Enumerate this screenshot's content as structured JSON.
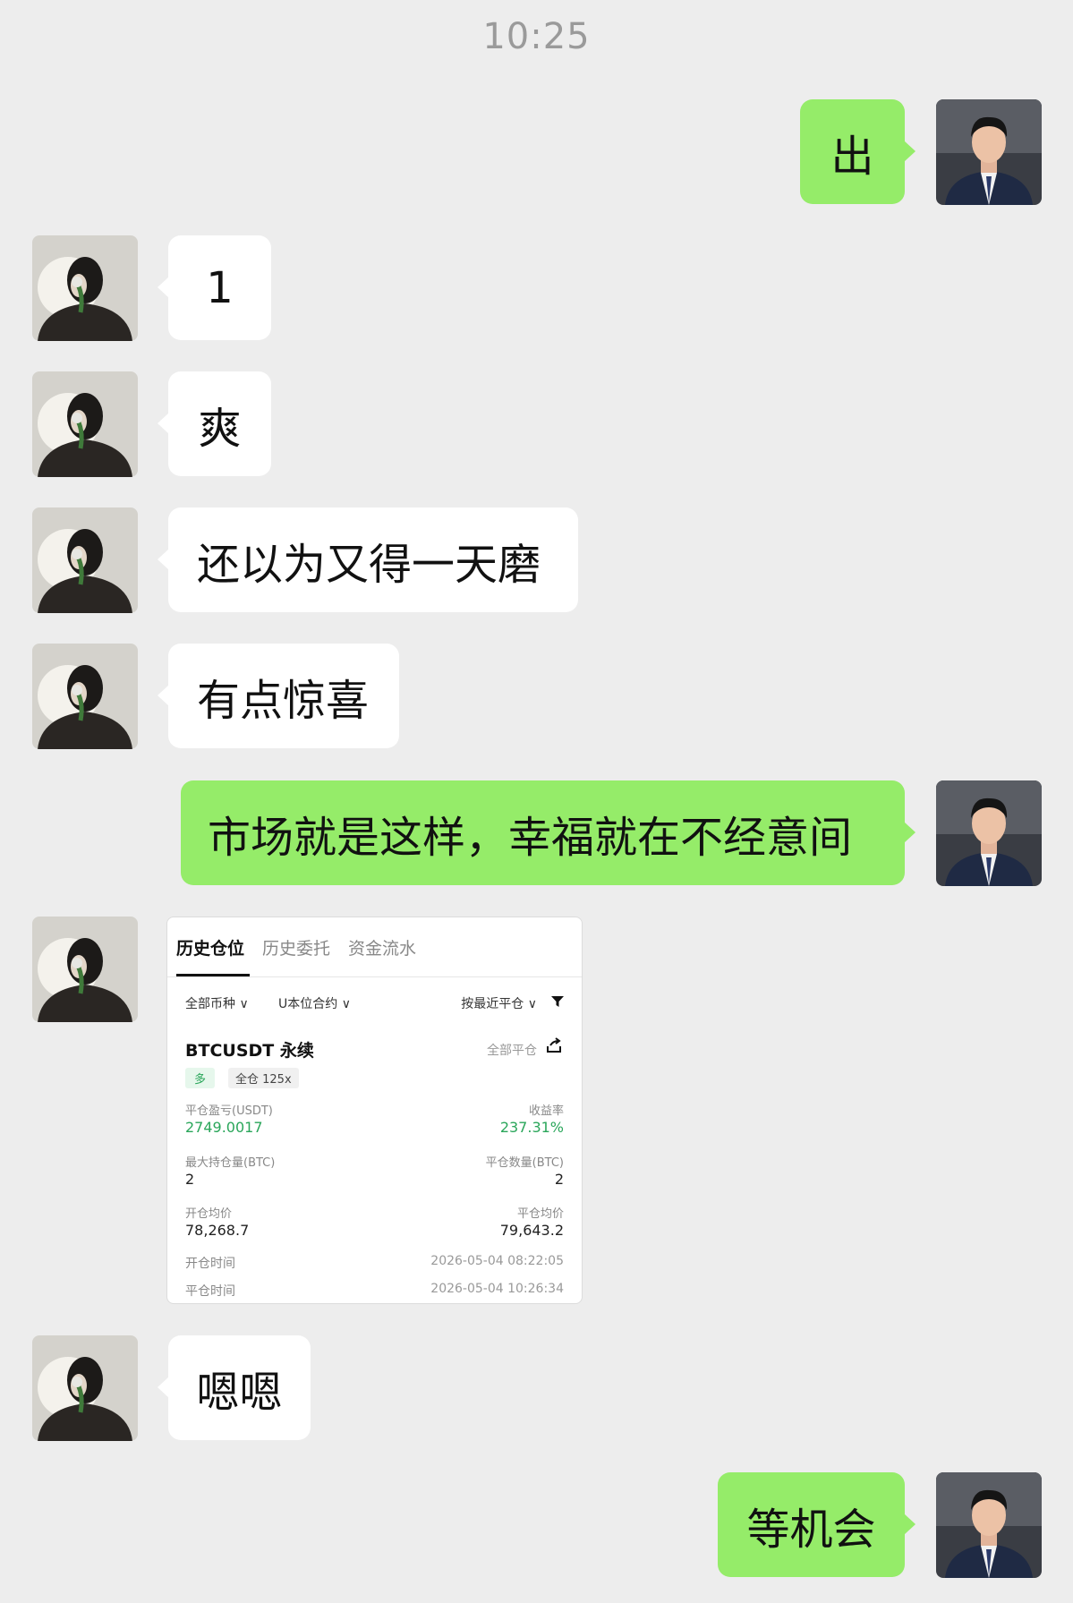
{
  "timestamp": "10:25",
  "messages": [
    {
      "side": "right",
      "text": "出"
    },
    {
      "side": "left",
      "text": "1"
    },
    {
      "side": "left",
      "text": "爽"
    },
    {
      "side": "left",
      "text": "还以为又得一天磨"
    },
    {
      "side": "left",
      "text": "有点惊喜"
    },
    {
      "side": "right",
      "text": "市场就是这样，幸福就在不经意间"
    },
    {
      "side": "left",
      "type": "image"
    },
    {
      "side": "left",
      "text": "嗯嗯"
    },
    {
      "side": "right",
      "text": "等机会"
    }
  ],
  "shared_image": {
    "tabs": [
      "历史仓位",
      "历史委托",
      "资金流水"
    ],
    "filters": {
      "coin": "全部币种 ∨",
      "contract": "U本位合约 ∨",
      "sort": "按最近平仓 ∨",
      "filter_icon": "funnel-icon"
    },
    "symbol": "BTCUSDT 永续",
    "close_all": "全部平仓",
    "side_tag": "多",
    "leverage_tag": "全仓 125x",
    "pnl_label": "平仓盈亏(USDT)",
    "pnl_value": "2749.0017",
    "roi_label": "收益率",
    "roi_value": "237.31%",
    "max_pos_label": "最大持仓量(BTC)",
    "max_pos_value": "2",
    "close_qty_label": "平仓数量(BTC)",
    "close_qty_value": "2",
    "open_avg_label": "开仓均价",
    "open_avg_value": "78,268.7",
    "close_avg_label": "平仓均价",
    "close_avg_value": "79,643.2",
    "open_time_label": "开仓时间",
    "open_time_value": "2026-05-04 08:22:05",
    "close_time_label": "平仓时间",
    "close_time_value": "2026-05-04 10:26:34"
  },
  "colors": {
    "background": "#ededed",
    "bubble_self": "#95ec69",
    "bubble_other": "#ffffff",
    "profit_green": "#2aa65a"
  }
}
